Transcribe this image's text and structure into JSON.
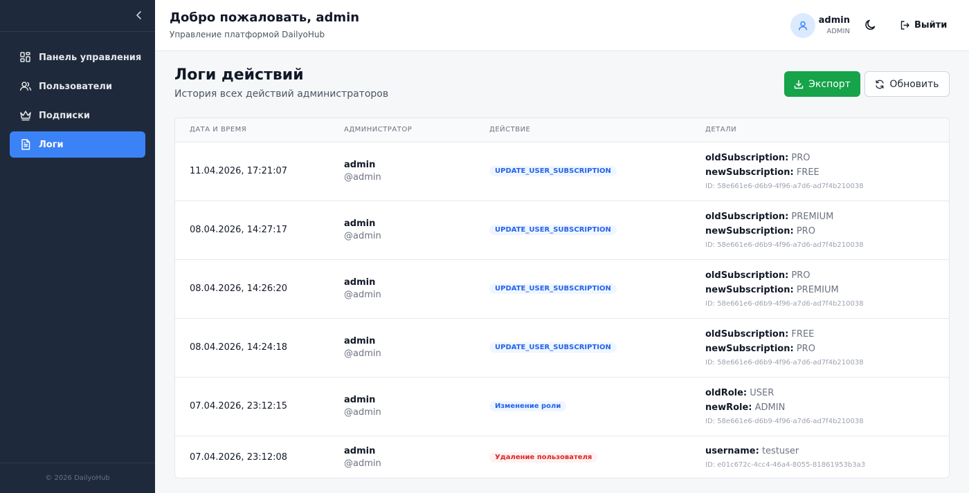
{
  "sidebar": {
    "collapse_icon": "chevron-left-icon",
    "items": [
      {
        "label": "Панель управления",
        "icon": "dashboard-grid-icon",
        "active": false
      },
      {
        "label": "Пользователи",
        "icon": "users-icon",
        "active": false
      },
      {
        "label": "Подписки",
        "icon": "crown-icon",
        "active": false
      },
      {
        "label": "Логи",
        "icon": "document-icon",
        "active": true
      }
    ],
    "footer": "© 2026 DailyoHub"
  },
  "header": {
    "title": "Добро пожаловать, admin",
    "subtitle": "Управление платформой DailyoHub",
    "user_name": "admin",
    "user_role": "ADMIN",
    "logout_label": "Выйти"
  },
  "page": {
    "title": "Логи действий",
    "subtitle": "История всех действий администраторов",
    "export_label": "Экспорт",
    "refresh_label": "Обновить"
  },
  "table": {
    "columns": [
      "ДАТА И ВРЕМЯ",
      "АДМИНИСТРАТОР",
      "ДЕЙСТВИЕ",
      "ДЕТАЛИ"
    ],
    "rows": [
      {
        "date": "11.04.2026, 17:21:07",
        "admin": "admin",
        "handle": "@admin",
        "action": "UPDATE_USER_SUBSCRIPTION",
        "k1": "oldSubscription:",
        "v1": " PRO",
        "k2": "newSubscription:",
        "v2": " FREE",
        "id": "ID: 58e661e6-d6b9-4f96-a7d6-ad7f4b210038"
      },
      {
        "date": "08.04.2026, 14:27:17",
        "admin": "admin",
        "handle": "@admin",
        "action": "UPDATE_USER_SUBSCRIPTION",
        "k1": "oldSubscription:",
        "v1": " PREMIUM",
        "k2": "newSubscription:",
        "v2": " PRO",
        "id": "ID: 58e661e6-d6b9-4f96-a7d6-ad7f4b210038"
      },
      {
        "date": "08.04.2026, 14:26:20",
        "admin": "admin",
        "handle": "@admin",
        "action": "UPDATE_USER_SUBSCRIPTION",
        "k1": "oldSubscription:",
        "v1": " PRO",
        "k2": "newSubscription:",
        "v2": " PREMIUM",
        "id": "ID: 58e661e6-d6b9-4f96-a7d6-ad7f4b210038"
      },
      {
        "date": "08.04.2026, 14:24:18",
        "admin": "admin",
        "handle": "@admin",
        "action": "UPDATE_USER_SUBSCRIPTION",
        "k1": "oldSubscription:",
        "v1": " FREE",
        "k2": "newSubscription:",
        "v2": " PRO",
        "id": "ID: 58e661e6-d6b9-4f96-a7d6-ad7f4b210038"
      },
      {
        "date": "07.04.2026, 23:12:15",
        "admin": "admin",
        "handle": "@admin",
        "action": "Изменение роли",
        "k1": "oldRole:",
        "v1": " USER",
        "k2": "newRole:",
        "v2": " ADMIN",
        "id": "ID: 58e661e6-d6b9-4f96-a7d6-ad7f4b210038"
      },
      {
        "date": "07.04.2026, 23:12:08",
        "admin": "admin",
        "handle": "@admin",
        "action": "Удаление пользователя",
        "k1": "username:",
        "v1": " testuser",
        "id": "ID: e01c672c-4cc4-46a4-8055-81861953b3a3"
      }
    ]
  },
  "colors": {
    "sidebar_bg": "#1e293b",
    "active_nav": "#3b82f6",
    "export_button": "#16a34a",
    "badge_blue": "#2563eb",
    "badge_red": "#dc2626"
  }
}
